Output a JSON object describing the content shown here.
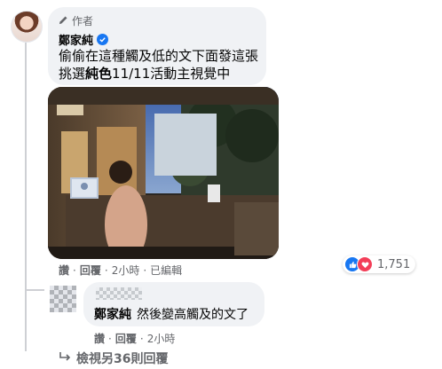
{
  "comment": {
    "author_badge": "作者",
    "author_name": "鄭家純",
    "text_line1": "偷偷在這種觸及低的文下面發這張",
    "text_line2_pre": "挑選",
    "text_line2_bold": "純色",
    "text_line2_post": "11/11活動主視覺中",
    "actions": {
      "like": "讚",
      "reply": "回覆",
      "time": "2小時",
      "edited": "已編輯"
    },
    "reaction_count": "1,751"
  },
  "reply": {
    "tag": "鄭家純",
    "text": "然後變高觸及的文了",
    "actions": {
      "like": "讚",
      "reply": "回覆",
      "time": "2小時"
    }
  },
  "view_more": {
    "label": "檢視另36則回覆"
  },
  "colors": {
    "accent": "#1877f2",
    "love": "#f33e58",
    "bubble": "#f0f2f5",
    "secondary_text": "#65676b"
  },
  "icons": [
    "pencil-icon",
    "verified-icon",
    "like-reaction-icon",
    "love-reaction-icon",
    "reply-arrow-icon"
  ]
}
